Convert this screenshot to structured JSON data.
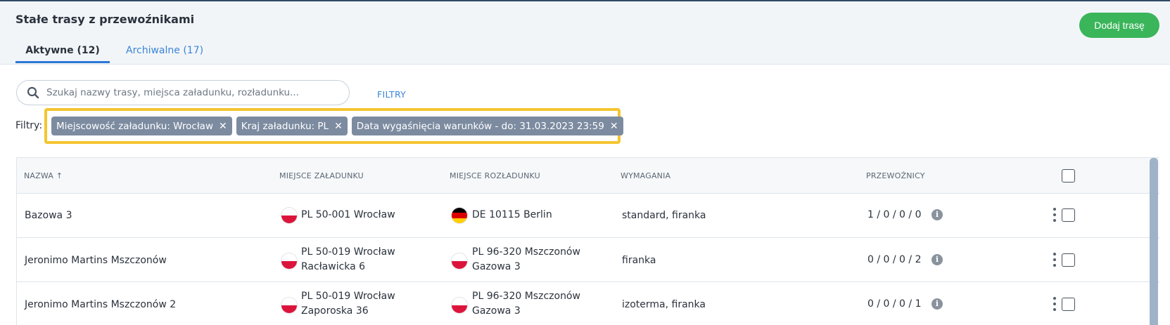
{
  "header": {
    "title": "Stałe trasy z przewoźnikami",
    "add_button": "Dodaj trasę",
    "tabs": [
      {
        "label": "Aktywne (12)",
        "active": true
      },
      {
        "label": "Archiwalne (17)",
        "active": false
      }
    ]
  },
  "search": {
    "placeholder": "Szukaj nazwy trasy, miejsca załadunku, rozładunku...",
    "value": ""
  },
  "filters": {
    "link_label": "FILTRY",
    "label": "Filtry:",
    "chips": [
      {
        "label": "Miejscowość załadunku: Wrocław"
      },
      {
        "label": "Kraj załadunku: PL"
      },
      {
        "label": "Data wygaśnięcia warunków - do: 31.03.2023 23:59"
      }
    ],
    "highlight_color": "#f4c531"
  },
  "table": {
    "columns": {
      "name": "NAZWA ↑",
      "loading": "MIEJSCE ZAŁADUNKU",
      "unloading": "MIEJSCE ROZŁADUNKU",
      "requirements": "WYMAGANIA",
      "carriers": "PRZEWOŹNICY"
    },
    "rows": [
      {
        "name": "Bazowa 3",
        "loading_country": "PL",
        "loading_line1": "PL 50-001 Wrocław",
        "loading_line2": "",
        "unloading_country": "DE",
        "unloading_line1": "DE 10115 Berlin",
        "unloading_line2": "",
        "requirements": "standard, firanka",
        "carriers": "1 / 0 / 0 / 0"
      },
      {
        "name": "Jeronimo Martins Mszczonów",
        "loading_country": "PL",
        "loading_line1": "PL 50-019 Wrocław",
        "loading_line2": "Racławicka 6",
        "unloading_country": "PL",
        "unloading_line1": "PL 96-320 Mszczonów",
        "unloading_line2": "Gazowa 3",
        "requirements": "firanka",
        "carriers": "0 / 0 / 0 / 2"
      },
      {
        "name": "Jeronimo Martins Mszczonów 2",
        "loading_country": "PL",
        "loading_line1": "PL 50-019 Wrocław",
        "loading_line2": "Zaporoska 36",
        "unloading_country": "PL",
        "unloading_line1": "PL 96-320 Mszczonów",
        "unloading_line2": "Gazowa 3",
        "requirements": "izoterma, firanka",
        "carriers": "0 / 0 / 0 / 1"
      }
    ]
  },
  "colors": {
    "accent": "#2b78d6",
    "primary_button": "#3ab55a",
    "chip": "#7c8ba0"
  }
}
